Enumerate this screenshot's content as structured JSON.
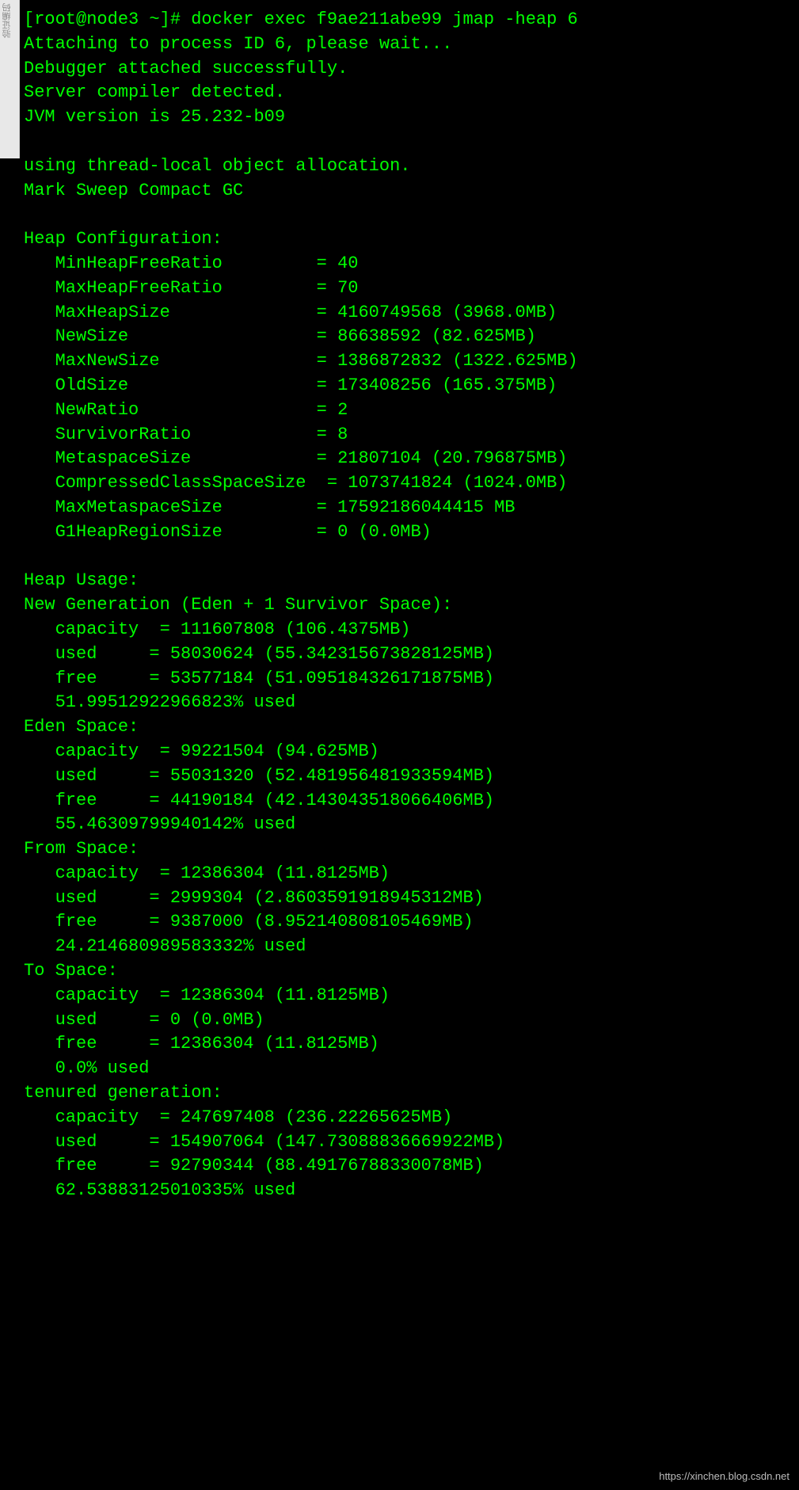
{
  "left_strip": "验证编码",
  "prompt": "[root@node3 ~]# ",
  "command": "docker exec f9ae211abe99 jmap -heap 6",
  "lines_top": [
    "Attaching to process ID 6, please wait...",
    "Debugger attached successfully.",
    "Server compiler detected.",
    "JVM version is 25.232-b09",
    "",
    "using thread-local object allocation.",
    "Mark Sweep Compact GC",
    ""
  ],
  "heap_cfg_header": "Heap Configuration:",
  "heap_cfg": [
    {
      "k": "MinHeapFreeRatio",
      "v": "40"
    },
    {
      "k": "MaxHeapFreeRatio",
      "v": "70"
    },
    {
      "k": "MaxHeapSize",
      "v": "4160749568 (3968.0MB)"
    },
    {
      "k": "NewSize",
      "v": "86638592 (82.625MB)"
    },
    {
      "k": "MaxNewSize",
      "v": "1386872832 (1322.625MB)"
    },
    {
      "k": "OldSize",
      "v": "173408256 (165.375MB)"
    },
    {
      "k": "NewRatio",
      "v": "2"
    },
    {
      "k": "SurvivorRatio",
      "v": "8"
    },
    {
      "k": "MetaspaceSize",
      "v": "21807104 (20.796875MB)"
    },
    {
      "k": "CompressedClassSpaceSize",
      "v": "1073741824 (1024.0MB)"
    },
    {
      "k": "MaxMetaspaceSize",
      "v": "17592186044415 MB"
    },
    {
      "k": "G1HeapRegionSize",
      "v": "0 (0.0MB)"
    }
  ],
  "heap_usage_header": "Heap Usage:",
  "sections": [
    {
      "title": "New Generation (Eden + 1 Survivor Space):",
      "rows": [
        {
          "k": "capacity",
          "v": "111607808 (106.4375MB)"
        },
        {
          "k": "used",
          "v": "58030624 (55.342315673828125MB)"
        },
        {
          "k": "free",
          "v": "53577184 (51.095184326171875MB)"
        }
      ],
      "pct": "51.99512922966823% used"
    },
    {
      "title": "Eden Space:",
      "rows": [
        {
          "k": "capacity",
          "v": "99221504 (94.625MB)"
        },
        {
          "k": "used",
          "v": "55031320 (52.481956481933594MB)"
        },
        {
          "k": "free",
          "v": "44190184 (42.143043518066406MB)"
        }
      ],
      "pct": "55.46309799940142% used"
    },
    {
      "title": "From Space:",
      "rows": [
        {
          "k": "capacity",
          "v": "12386304 (11.8125MB)"
        },
        {
          "k": "used",
          "v": "2999304 (2.8603591918945312MB)"
        },
        {
          "k": "free",
          "v": "9387000 (8.952140808105469MB)"
        }
      ],
      "pct": "24.214680989583332% used"
    },
    {
      "title": "To Space:",
      "rows": [
        {
          "k": "capacity",
          "v": "12386304 (11.8125MB)"
        },
        {
          "k": "used",
          "v": "0 (0.0MB)"
        },
        {
          "k": "free",
          "v": "12386304 (11.8125MB)"
        }
      ],
      "pct": "0.0% used"
    },
    {
      "title": "tenured generation:",
      "rows": [
        {
          "k": "capacity",
          "v": "247697408 (236.22265625MB)"
        },
        {
          "k": "used",
          "v": "154907064 (147.73088836669922MB)"
        },
        {
          "k": "free",
          "v": "92790344 (88.49176788330078MB)"
        }
      ],
      "pct": "62.53883125010335% used"
    }
  ],
  "watermark": "https://xinchen.blog.csdn.net"
}
